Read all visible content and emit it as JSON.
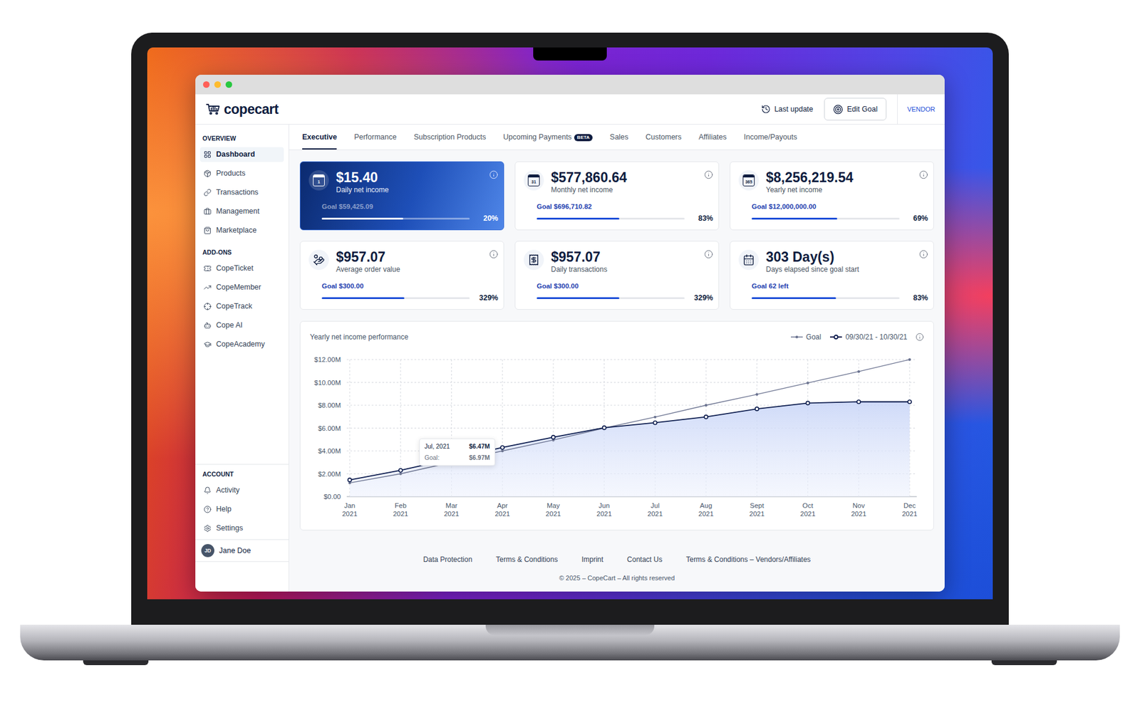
{
  "window_controls": [
    {
      "color": "#ff5f57"
    },
    {
      "color": "#febc2e"
    },
    {
      "color": "#28c840"
    }
  ],
  "header": {
    "logo": "copecart",
    "last_update": "Last update",
    "edit_goal": "Edit Goal",
    "role": "VENDOR"
  },
  "sidebar": {
    "sections": [
      {
        "title": "OVERVIEW",
        "items": [
          {
            "label": "Dashboard",
            "selected": true
          },
          {
            "label": "Products",
            "selected": false
          },
          {
            "label": "Transactions",
            "selected": false
          },
          {
            "label": "Management",
            "selected": false
          },
          {
            "label": "Marketplace",
            "selected": false
          }
        ]
      },
      {
        "title": "ADD-ONS",
        "items": [
          {
            "label": "CopeTicket",
            "selected": false
          },
          {
            "label": "CopeMember",
            "selected": false
          },
          {
            "label": "CopeTrack",
            "selected": false
          },
          {
            "label": "Cope AI",
            "selected": false
          },
          {
            "label": "CopeAcademy",
            "selected": false
          }
        ]
      }
    ],
    "account": {
      "title": "ACCOUNT",
      "items": [
        {
          "label": "Activity",
          "selected": false
        },
        {
          "label": "Help",
          "selected": false
        },
        {
          "label": "Settings",
          "selected": false
        }
      ]
    },
    "user": {
      "initials": "JD",
      "name": "Jane Doe"
    }
  },
  "tabs": [
    {
      "label": "Executive",
      "selected": true,
      "badge": ""
    },
    {
      "label": "Performance",
      "selected": false,
      "badge": ""
    },
    {
      "label": "Subscription Products",
      "selected": false,
      "badge": ""
    },
    {
      "label": "Upcoming Payments",
      "selected": false,
      "badge": "BETA"
    },
    {
      "label": "Sales",
      "selected": false,
      "badge": ""
    },
    {
      "label": "Customers",
      "selected": false,
      "badge": ""
    },
    {
      "label": "Affiliates",
      "selected": false,
      "badge": ""
    },
    {
      "label": "Income/Payouts",
      "selected": false,
      "badge": ""
    }
  ],
  "cards": [
    {
      "kind": "calendar-number",
      "icon_text": "1",
      "value": "$15.40",
      "label": "Daily net income",
      "goal": "Goal $59,425.09",
      "percent": "20%",
      "level": 0.55,
      "highlighted": true
    },
    {
      "kind": "calendar-number",
      "icon_text": "31",
      "value": "$577,860.64",
      "label": "Monthly net income",
      "goal": "Goal $696,710.82",
      "percent": "83%",
      "level": 0.56,
      "highlighted": false
    },
    {
      "kind": "calendar-number",
      "icon_text": "365",
      "value": "$8,256,219.54",
      "label": "Yearly net income",
      "goal": "Goal $12,000,000.00",
      "percent": "69%",
      "level": 0.58,
      "highlighted": false
    },
    {
      "kind": "hand-coins",
      "icon_text": "",
      "value": "$957.07",
      "label": "Average order value",
      "goal": "Goal $300.00",
      "percent": "329%",
      "level": 0.56,
      "highlighted": false
    },
    {
      "kind": "terminal",
      "icon_text": "",
      "value": "$957.07",
      "label": "Daily transactions",
      "goal": "Goal $300.00",
      "percent": "329%",
      "level": 0.56,
      "highlighted": false
    },
    {
      "kind": "calendar-grid",
      "icon_text": "",
      "value": "303 Day(s)",
      "label": "Days elapsed since goal start",
      "goal": "Goal 62 left",
      "percent": "83%",
      "level": 0.57,
      "highlighted": false
    }
  ],
  "chart": {
    "title": "Yearly net income performance",
    "max": 12,
    "y_ticks": [
      "$12.00M",
      "$10.00M",
      "$8.00M",
      "$6.00M",
      "$4.00M",
      "$2.00M",
      "$0.00"
    ],
    "months": [
      {
        "month": "Jan",
        "year": "2021"
      },
      {
        "month": "Feb",
        "year": "2021"
      },
      {
        "month": "Mar",
        "year": "2021"
      },
      {
        "month": "Apr",
        "year": "2021"
      },
      {
        "month": "May",
        "year": "2021"
      },
      {
        "month": "Jun",
        "year": "2021"
      },
      {
        "month": "Jul",
        "year": "2021"
      },
      {
        "month": "Aug",
        "year": "2021"
      },
      {
        "month": "Sept",
        "year": "2021"
      },
      {
        "month": "Oct",
        "year": "2021"
      },
      {
        "month": "Nov",
        "year": "2021"
      },
      {
        "month": "Dec",
        "year": "2021"
      }
    ],
    "series": [
      {
        "name": "Goal",
        "kind": "goal",
        "color": "#6b7390",
        "values": [
          1.2,
          2.0,
          3.0,
          4.0,
          4.95,
          6.0,
          6.97,
          8.0,
          8.95,
          9.95,
          10.95,
          12.0
        ]
      },
      {
        "name": "09/30/21 - 10/30/21",
        "kind": "actual",
        "color": "#0b1b4d",
        "values": [
          1.46,
          2.3,
          3.3,
          4.3,
          5.2,
          6.03,
          6.47,
          6.98,
          7.68,
          8.19,
          8.3,
          8.3
        ]
      }
    ],
    "tooltip": {
      "title": "Jul, 2021",
      "value": "$6.47M",
      "goal_label": "Goal:",
      "goal_value": "$6.97M"
    }
  },
  "footer": {
    "links": [
      "Data Protection",
      "Terms & Conditions",
      "Imprint",
      "Contact Us",
      "Terms & Conditions – Vendors/Affiliates"
    ],
    "copyright": "© 2025 – CopeCart – All rights reserved"
  }
}
